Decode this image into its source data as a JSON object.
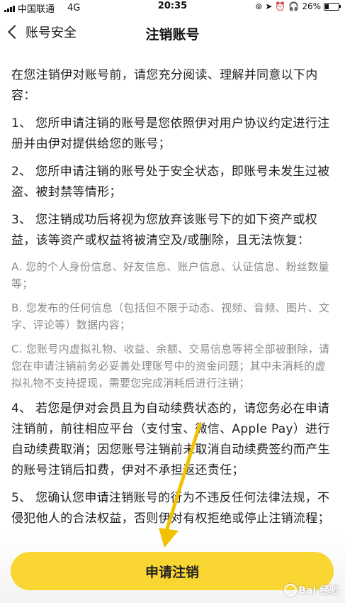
{
  "status": {
    "carrier": "中国联通",
    "network": "4G",
    "time": "20:35",
    "battery": "26%",
    "battery_level": 0.26
  },
  "nav": {
    "back_label": "账号安全",
    "title": "注销账号"
  },
  "content": {
    "intro": "在您注销伊对账号前，请您充分阅读、理解并同意以下内容：",
    "item1": "1、 您所申请注销的账号是您依照伊对用户协议约定进行注册并由伊对提供给您的账号；",
    "item2": "2、 您所申请注销的账号处于安全状态，即账号未发生过被盗、被封禁等情形；",
    "item3": "3、 您注销成功后将视为您放弃该账号下的如下资产或权益，该等资产或权益将被清空及/或删除，且无法恢复：",
    "subA": "A. 您的个人身份信息、好友信息、账户信息、认证信息、粉丝数量等；",
    "subB": "B. 您发布的任何信息（包括但不限于动态、视频、音频、图片、文字、评论等）数据内容；",
    "subC": "C. 您账号内虚拟礼物、收益、余额、交易信息等将全部被删除，请您在申请注销前务必妥善处理账号中的资金问题；其中未消耗的虚拟礼物不支持提现，需要您完成消耗后进行注销；",
    "item4": "4、 若您是伊对会员且为自动续费状态的，请您务必在申请注销前，前往相应平台（支付宝、微信、Apple Pay）进行自动续费取消；因您账号注销前未取消自动续费签约而产生的账号注销后扣费，伊对不承担返还责任；",
    "item5": "5、 您确认您申请注销账号的行为不违反任何法律法规，不侵犯他人的合法权益，否则伊对有权拒绝或停止注销流程；"
  },
  "footer": {
    "apply_button": "申请注销"
  },
  "watermark": {
    "text": "Bai  经验"
  },
  "colors": {
    "accent": "#f9d632",
    "arrow": "#f2c200"
  }
}
